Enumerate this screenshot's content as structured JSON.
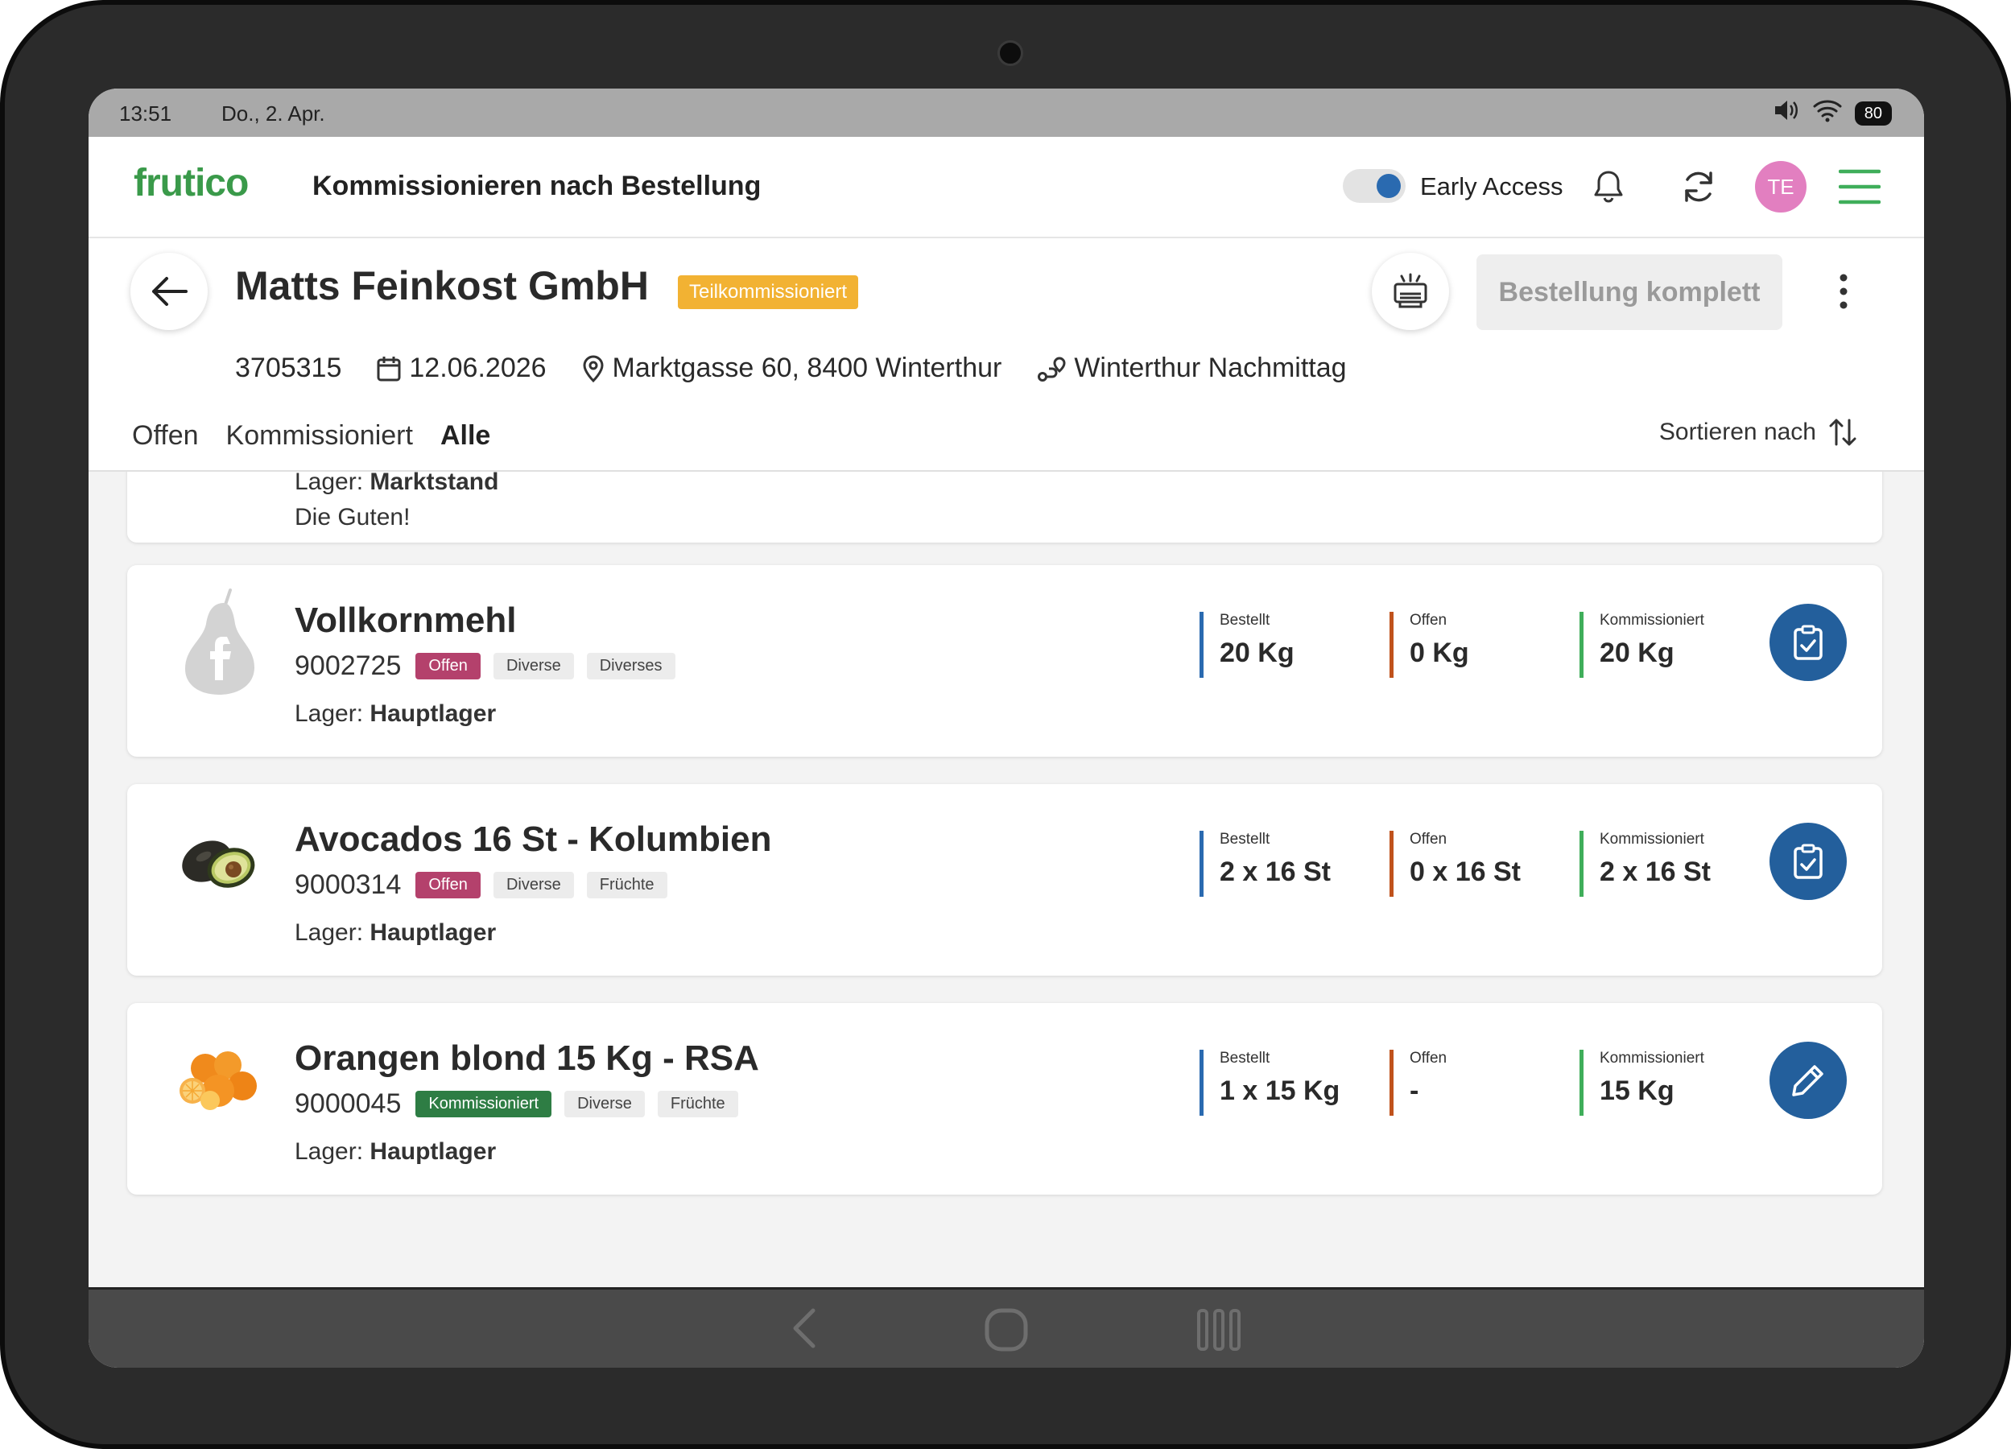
{
  "status_bar": {
    "time": "13:51",
    "date": "Do., 2. Apr.",
    "battery": "80"
  },
  "header": {
    "logo": "frutico",
    "title": "Kommissionieren nach Bestellung",
    "early_access_label": "Early Access",
    "early_access_on": true,
    "avatar_initials": "TE"
  },
  "order": {
    "customer": "Matts Feinkost GmbH",
    "status": "Teilkommissioniert",
    "complete_button": "Bestellung komplett",
    "number": "3705315",
    "date": "12.06.2026",
    "address": "Marktgasse 60, 8400 Winterthur",
    "route": "Winterthur Nachmittag"
  },
  "tabs": [
    {
      "label": "Offen",
      "active": false
    },
    {
      "label": "Kommissioniert",
      "active": false
    },
    {
      "label": "Alle",
      "active": true
    }
  ],
  "sort_label": "Sortieren nach",
  "labels": {
    "lager": "Lager:",
    "bestellt": "Bestellt",
    "offen": "Offen",
    "kommissioniert": "Kommissioniert"
  },
  "previous_item": {
    "lager": "Marktstand",
    "note": "Die Guten!"
  },
  "items": [
    {
      "name": "Vollkornmehl",
      "number": "9002725",
      "status": "Offen",
      "tags": [
        "Diverse",
        "Diverses"
      ],
      "lager": "Hauptlager",
      "bestellt": "20 Kg",
      "offen": "0 Kg",
      "kommissioniert": "20 Kg",
      "image": "placeholder-pear-icon",
      "action": "clipboard-check-icon"
    },
    {
      "name": "Avocados 16 St - Kolumbien",
      "number": "9000314",
      "status": "Offen",
      "tags": [
        "Diverse",
        "Früchte"
      ],
      "lager": "Hauptlager",
      "bestellt": "2 x 16 St",
      "offen": "0 x 16 St",
      "kommissioniert": "2 x 16 St",
      "image": "avocado-image",
      "action": "clipboard-check-icon"
    },
    {
      "name": "Orangen blond 15 Kg - RSA",
      "number": "9000045",
      "status": "Kommissioniert",
      "tags": [
        "Diverse",
        "Früchte"
      ],
      "lager": "Hauptlager",
      "bestellt": "1 x 15 Kg",
      "offen": "-",
      "kommissioniert": "15 Kg",
      "image": "orange-image",
      "action": "pencil-icon"
    }
  ],
  "colors": {
    "brand_green": "#3a9a4a",
    "primary_blue": "#235f9c",
    "badge_orange": "#f2b233",
    "offen_tag": "#b4416c",
    "kommissioniert_tag": "#2e7d44",
    "bestellt_bar": "#2a6ab0",
    "offen_bar": "#c0521c",
    "kommissioniert_bar": "#3fae5a"
  }
}
